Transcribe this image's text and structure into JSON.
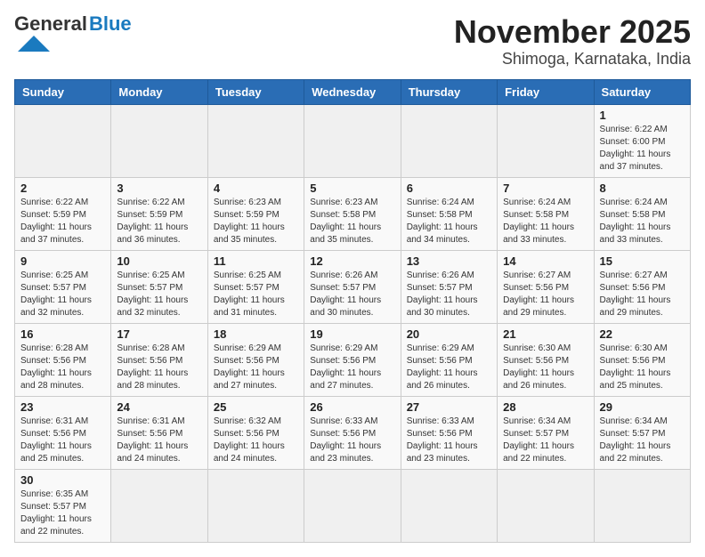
{
  "logo": {
    "text_general": "General",
    "text_blue": "Blue"
  },
  "header": {
    "month": "November 2025",
    "location": "Shimoga, Karnataka, India"
  },
  "days_of_week": [
    "Sunday",
    "Monday",
    "Tuesday",
    "Wednesday",
    "Thursday",
    "Friday",
    "Saturday"
  ],
  "weeks": [
    [
      {
        "day": "",
        "info": ""
      },
      {
        "day": "",
        "info": ""
      },
      {
        "day": "",
        "info": ""
      },
      {
        "day": "",
        "info": ""
      },
      {
        "day": "",
        "info": ""
      },
      {
        "day": "",
        "info": ""
      },
      {
        "day": "1",
        "info": "Sunrise: 6:22 AM\nSunset: 6:00 PM\nDaylight: 11 hours\nand 37 minutes."
      }
    ],
    [
      {
        "day": "2",
        "info": "Sunrise: 6:22 AM\nSunset: 5:59 PM\nDaylight: 11 hours\nand 37 minutes."
      },
      {
        "day": "3",
        "info": "Sunrise: 6:22 AM\nSunset: 5:59 PM\nDaylight: 11 hours\nand 36 minutes."
      },
      {
        "day": "4",
        "info": "Sunrise: 6:23 AM\nSunset: 5:59 PM\nDaylight: 11 hours\nand 35 minutes."
      },
      {
        "day": "5",
        "info": "Sunrise: 6:23 AM\nSunset: 5:58 PM\nDaylight: 11 hours\nand 35 minutes."
      },
      {
        "day": "6",
        "info": "Sunrise: 6:24 AM\nSunset: 5:58 PM\nDaylight: 11 hours\nand 34 minutes."
      },
      {
        "day": "7",
        "info": "Sunrise: 6:24 AM\nSunset: 5:58 PM\nDaylight: 11 hours\nand 33 minutes."
      },
      {
        "day": "8",
        "info": "Sunrise: 6:24 AM\nSunset: 5:58 PM\nDaylight: 11 hours\nand 33 minutes."
      }
    ],
    [
      {
        "day": "9",
        "info": "Sunrise: 6:25 AM\nSunset: 5:57 PM\nDaylight: 11 hours\nand 32 minutes."
      },
      {
        "day": "10",
        "info": "Sunrise: 6:25 AM\nSunset: 5:57 PM\nDaylight: 11 hours\nand 32 minutes."
      },
      {
        "day": "11",
        "info": "Sunrise: 6:25 AM\nSunset: 5:57 PM\nDaylight: 11 hours\nand 31 minutes."
      },
      {
        "day": "12",
        "info": "Sunrise: 6:26 AM\nSunset: 5:57 PM\nDaylight: 11 hours\nand 30 minutes."
      },
      {
        "day": "13",
        "info": "Sunrise: 6:26 AM\nSunset: 5:57 PM\nDaylight: 11 hours\nand 30 minutes."
      },
      {
        "day": "14",
        "info": "Sunrise: 6:27 AM\nSunset: 5:56 PM\nDaylight: 11 hours\nand 29 minutes."
      },
      {
        "day": "15",
        "info": "Sunrise: 6:27 AM\nSunset: 5:56 PM\nDaylight: 11 hours\nand 29 minutes."
      }
    ],
    [
      {
        "day": "16",
        "info": "Sunrise: 6:28 AM\nSunset: 5:56 PM\nDaylight: 11 hours\nand 28 minutes."
      },
      {
        "day": "17",
        "info": "Sunrise: 6:28 AM\nSunset: 5:56 PM\nDaylight: 11 hours\nand 28 minutes."
      },
      {
        "day": "18",
        "info": "Sunrise: 6:29 AM\nSunset: 5:56 PM\nDaylight: 11 hours\nand 27 minutes."
      },
      {
        "day": "19",
        "info": "Sunrise: 6:29 AM\nSunset: 5:56 PM\nDaylight: 11 hours\nand 27 minutes."
      },
      {
        "day": "20",
        "info": "Sunrise: 6:29 AM\nSunset: 5:56 PM\nDaylight: 11 hours\nand 26 minutes."
      },
      {
        "day": "21",
        "info": "Sunrise: 6:30 AM\nSunset: 5:56 PM\nDaylight: 11 hours\nand 26 minutes."
      },
      {
        "day": "22",
        "info": "Sunrise: 6:30 AM\nSunset: 5:56 PM\nDaylight: 11 hours\nand 25 minutes."
      }
    ],
    [
      {
        "day": "23",
        "info": "Sunrise: 6:31 AM\nSunset: 5:56 PM\nDaylight: 11 hours\nand 25 minutes."
      },
      {
        "day": "24",
        "info": "Sunrise: 6:31 AM\nSunset: 5:56 PM\nDaylight: 11 hours\nand 24 minutes."
      },
      {
        "day": "25",
        "info": "Sunrise: 6:32 AM\nSunset: 5:56 PM\nDaylight: 11 hours\nand 24 minutes."
      },
      {
        "day": "26",
        "info": "Sunrise: 6:33 AM\nSunset: 5:56 PM\nDaylight: 11 hours\nand 23 minutes."
      },
      {
        "day": "27",
        "info": "Sunrise: 6:33 AM\nSunset: 5:56 PM\nDaylight: 11 hours\nand 23 minutes."
      },
      {
        "day": "28",
        "info": "Sunrise: 6:34 AM\nSunset: 5:57 PM\nDaylight: 11 hours\nand 22 minutes."
      },
      {
        "day": "29",
        "info": "Sunrise: 6:34 AM\nSunset: 5:57 PM\nDaylight: 11 hours\nand 22 minutes."
      }
    ],
    [
      {
        "day": "30",
        "info": "Sunrise: 6:35 AM\nSunset: 5:57 PM\nDaylight: 11 hours\nand 22 minutes."
      },
      {
        "day": "",
        "info": ""
      },
      {
        "day": "",
        "info": ""
      },
      {
        "day": "",
        "info": ""
      },
      {
        "day": "",
        "info": ""
      },
      {
        "day": "",
        "info": ""
      },
      {
        "day": "",
        "info": ""
      }
    ]
  ]
}
